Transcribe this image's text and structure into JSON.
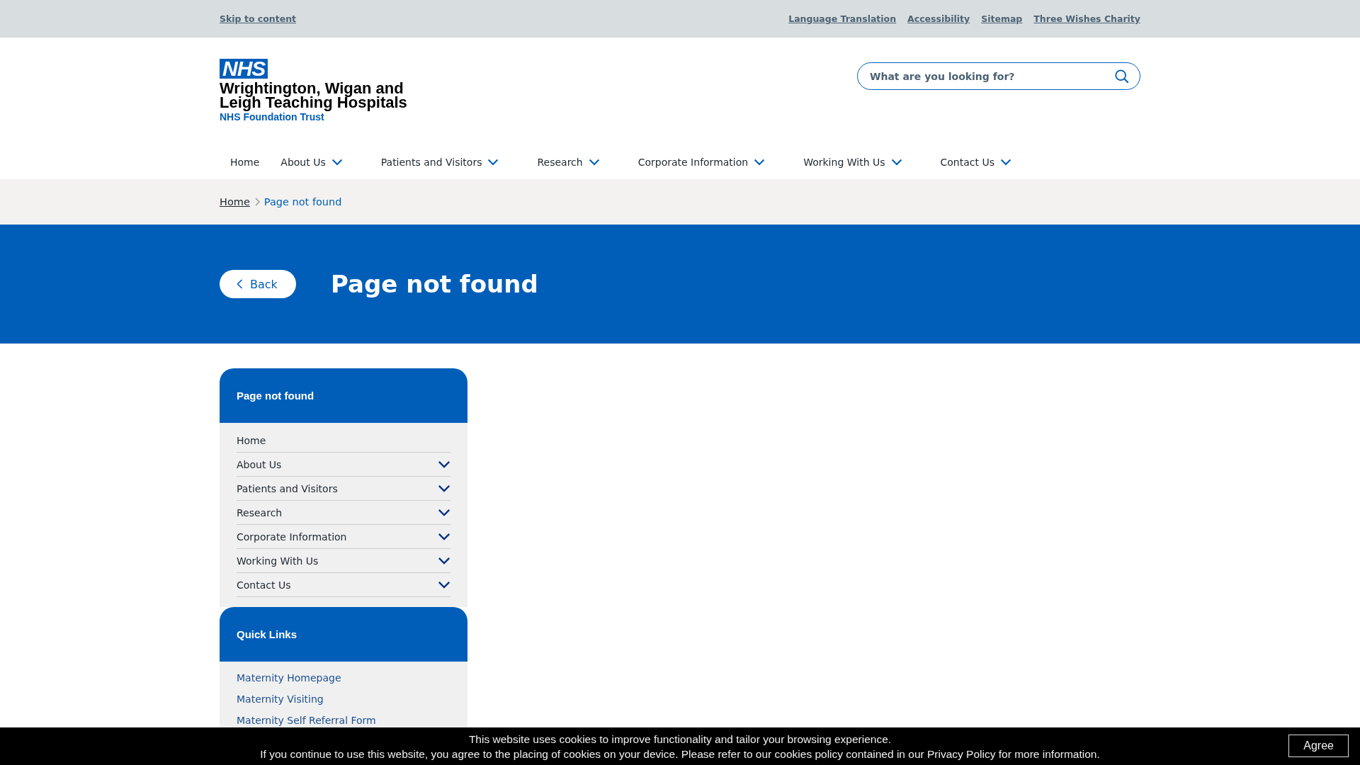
{
  "utility_bar": {
    "skip_link": "Skip to content",
    "links": [
      "Language Translation",
      "Accessibility",
      "Sitemap",
      "Three Wishes Charity"
    ]
  },
  "logo": {
    "badge": "NHS",
    "name_lines": [
      "Wrightington, Wigan and",
      "Leigh Teaching Hospitals"
    ],
    "subtitle": "NHS Foundation Trust"
  },
  "search": {
    "placeholder": "What are you looking for?"
  },
  "nav": [
    {
      "label": "Home",
      "has_dropdown": false
    },
    {
      "label": "About Us",
      "has_dropdown": true
    },
    {
      "label": "Patients and Visitors",
      "has_dropdown": true
    },
    {
      "label": "Research",
      "has_dropdown": true
    },
    {
      "label": "Corporate Information",
      "has_dropdown": true
    },
    {
      "label": "Working With Us",
      "has_dropdown": true
    },
    {
      "label": "Contact Us",
      "has_dropdown": true
    }
  ],
  "breadcrumb": [
    {
      "label": "Home",
      "current": false
    },
    {
      "label": "Page not found",
      "current": true
    }
  ],
  "hero": {
    "back_button": "Back",
    "title": "Page not found"
  },
  "sidebar_menu": {
    "title": "Page not found",
    "items": [
      {
        "label": "Home",
        "expandable": false
      },
      {
        "label": "About Us",
        "expandable": true
      },
      {
        "label": "Patients and Visitors",
        "expandable": true
      },
      {
        "label": "Research",
        "expandable": true
      },
      {
        "label": "Corporate Information",
        "expandable": true
      },
      {
        "label": "Working With Us",
        "expandable": true
      },
      {
        "label": "Contact Us",
        "expandable": true
      }
    ]
  },
  "quick_links": {
    "title": "Quick Links",
    "links": [
      "Maternity Homepage",
      "Maternity Visiting",
      "Maternity Self Referral Form"
    ]
  },
  "cookie_banner": {
    "lines": [
      "This website uses cookies to improve functionality and tailor your browsing experience.",
      "If you continue to use this website, you agree to the placing of cookies on your device. Please refer to our cookies policy contained in our Privacy Policy for more information."
    ],
    "button": "Agree"
  }
}
